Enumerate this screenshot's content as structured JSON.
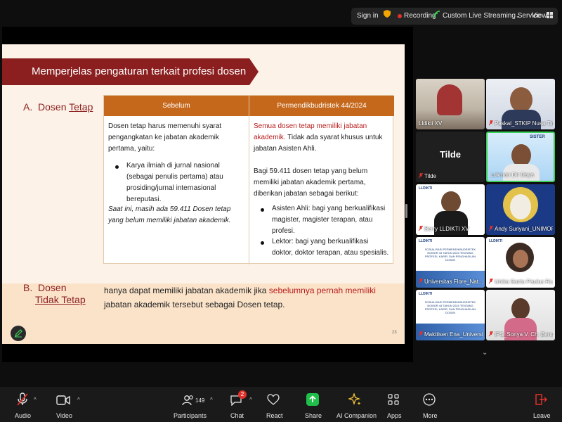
{
  "topbar": {
    "sign_in": "Sign in",
    "recording": "Recording",
    "streaming": "Custom Live Streaming Service",
    "view": "View",
    "recording_color": "#e0312b",
    "streaming_color": "#3ccf5a",
    "shield_color": "#f0a500"
  },
  "slide": {
    "banner": "Memperjelas pengaturan terkait profesi dosen",
    "banner_color": "#8b1e1e",
    "section_a": {
      "letter": "A.",
      "word1": "Dosen",
      "word2": "Tetap"
    },
    "section_b": {
      "letter": "B.",
      "line1": "Dosen",
      "line2": "Tidak Tetap"
    },
    "table": {
      "col1_header": "Sebelum",
      "col2_header": "Permendikbudristek 44/2024",
      "header_color": "#c5681b",
      "col1": {
        "p1_a": "Dosen tetap ",
        "p1_b": "harus memenuhi syarat",
        "p1_c": "pengangkatan ke jabatan akademik pertama",
        "p1_d": ",",
        "p1_e": "yaitu:",
        "bullet": "Karya ilmiah di jurnal nasional (sebagai penulis pertama) atau prosiding/jurnal internasional bereputasi.",
        "note_a": "Saat ini, masih ada 59.411 Dosen tetap yang",
        "note_b": "belum",
        "note_c": " memiliki jabatan akademik."
      },
      "col2": {
        "p1_red": "Semua dosen tetap memiliki jabatan",
        "p1_red2": "akademik.",
        "p1_rest": " Tidak ada syarat khusus untuk",
        "p1_rest2": "jabatan Asisten Ahli.",
        "p2": "Bagi 59.411 dosen tetap yang belum memiliki jabatan akademik pertama, diberikan jabatan sebagai berikut:",
        "bullet1": "Asisten Ahli: bagi yang berkualifikasi magister, magister terapan, atau profesi.",
        "bullet2": "Lektor: bagi yang berkualifikasi doktor, doktor terapan, atau spesialis."
      }
    },
    "section_b_text_a": "hanya dapat memiliki jabatan akademik jika ",
    "section_b_text_red": "sebelumnya pernah memiliki",
    "section_b_text_b": "jabatan akademik tersebut sebagai Dosen tetap.",
    "page_number": "23"
  },
  "participants": [
    {
      "name": "Lldikti XV"
    },
    {
      "name": "Paskal_STKIP Nusa Tim..."
    },
    {
      "name": "Tilde",
      "big_label": "Tilde"
    },
    {
      "name": "Lukman Dir Daya"
    },
    {
      "name": "Berry LLDIKTI XV"
    },
    {
      "name": "Andy Suriyani_UNIMOF"
    },
    {
      "name": "Universitas Flore_Nat..."
    },
    {
      "name": "Unika Santu Paulus Ru..."
    },
    {
      "name": "Maktilsen Ena_Universi..."
    },
    {
      "name": "IPS_Sonya V. Ch. Benu"
    }
  ],
  "tile_doc_title": "SOSIALISASI PERMENDIKBUDRISTEK NOMOR 44 TAHUN 2024 TENTANG PROFESI, KARIR, DAN PENGHASILAN DOSEN",
  "tile_logo": "LLDIKTI",
  "tile_banner_text": "SISTER",
  "toolbar": {
    "audio": "Audio",
    "video": "Video",
    "participants": "Participants",
    "participants_count": "149",
    "chat": "Chat",
    "chat_badge": "2",
    "react": "React",
    "share": "Share",
    "ai_companion": "AI Companion",
    "apps": "Apps",
    "more": "More",
    "leave": "Leave",
    "share_color": "#1fbf4a",
    "leave_color": "#e0312b"
  }
}
